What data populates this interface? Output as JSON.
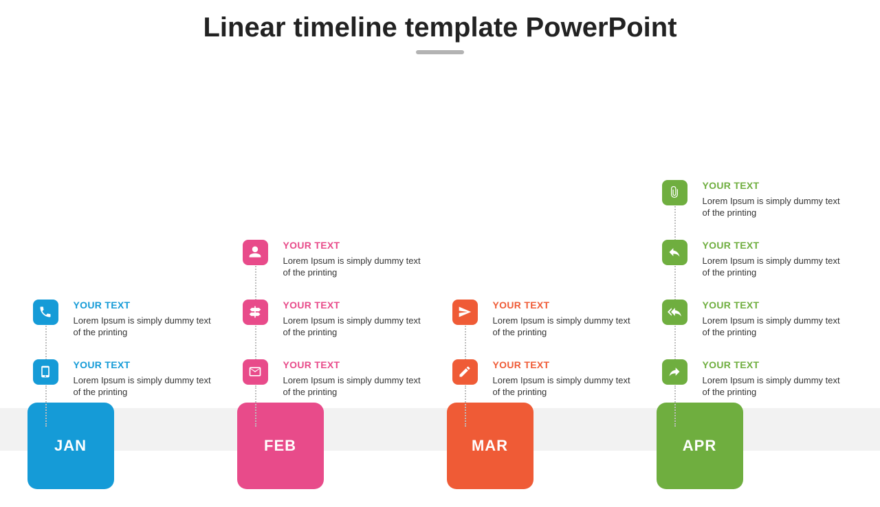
{
  "title": "Linear timeline template PowerPoint",
  "item_heading": "YOUR TEXT",
  "item_body": "Lorem Ipsum is simply dummy text of the printing",
  "columns": [
    {
      "month": "JAN",
      "color": "blue",
      "items": [
        {
          "icon": "phone"
        },
        {
          "icon": "mobile"
        }
      ]
    },
    {
      "month": "FEB",
      "color": "pink",
      "items": [
        {
          "icon": "user"
        },
        {
          "icon": "signpost"
        },
        {
          "icon": "mail"
        }
      ]
    },
    {
      "month": "MAR",
      "color": "orange",
      "items": [
        {
          "icon": "send"
        },
        {
          "icon": "pencil"
        }
      ]
    },
    {
      "month": "APR",
      "color": "green",
      "items": [
        {
          "icon": "paperclip"
        },
        {
          "icon": "reply"
        },
        {
          "icon": "reply-all"
        },
        {
          "icon": "forward"
        }
      ]
    }
  ]
}
